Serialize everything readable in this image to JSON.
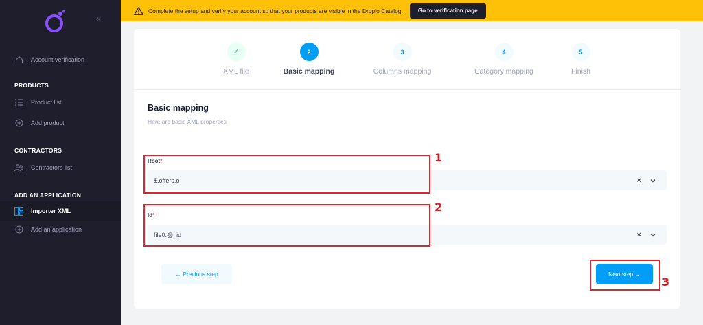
{
  "sidebar": {
    "collapse_icon": "double-chevron-left",
    "account_verification": "Account verification",
    "sections": {
      "products": "PRODUCTS",
      "contractors": "CONTRACTORS",
      "applications": "ADD AN APPLICATION"
    },
    "items": {
      "product_list": "Product list",
      "add_product": "Add product",
      "contractors_list": "Contractors list",
      "importer_xml": "Importer XML",
      "add_application": "Add an application"
    }
  },
  "banner": {
    "message": "Complete the setup and verify your account so that your products are visible in the Droplo Catalog.",
    "button": "Go to verification page",
    "color": "#ffc107"
  },
  "stepper": {
    "steps": [
      {
        "indicator": "✓",
        "label": "XML file",
        "state": "done"
      },
      {
        "indicator": "2",
        "label": "Basic mapping",
        "state": "current"
      },
      {
        "indicator": "3",
        "label": "Columns mapping",
        "state": "todo"
      },
      {
        "indicator": "4",
        "label": "Category mapping",
        "state": "todo"
      },
      {
        "indicator": "5",
        "label": "Finish",
        "state": "todo"
      }
    ]
  },
  "form": {
    "title": "Basic mapping",
    "subtitle": "Here are basic XML properties",
    "fields": [
      {
        "label": "Root",
        "required": "*",
        "value": "$.offers.o"
      },
      {
        "label": "id",
        "required": "*",
        "value": "file0:@_id"
      }
    ],
    "clear_glyph": "×"
  },
  "buttons": {
    "previous": "← Previous step",
    "next": "Next step →"
  },
  "annotations": [
    "1",
    "2",
    "3"
  ],
  "colors": {
    "accent": "#009ef7",
    "sidebar": "#1e1e2d",
    "annotation": "#e3242b"
  }
}
